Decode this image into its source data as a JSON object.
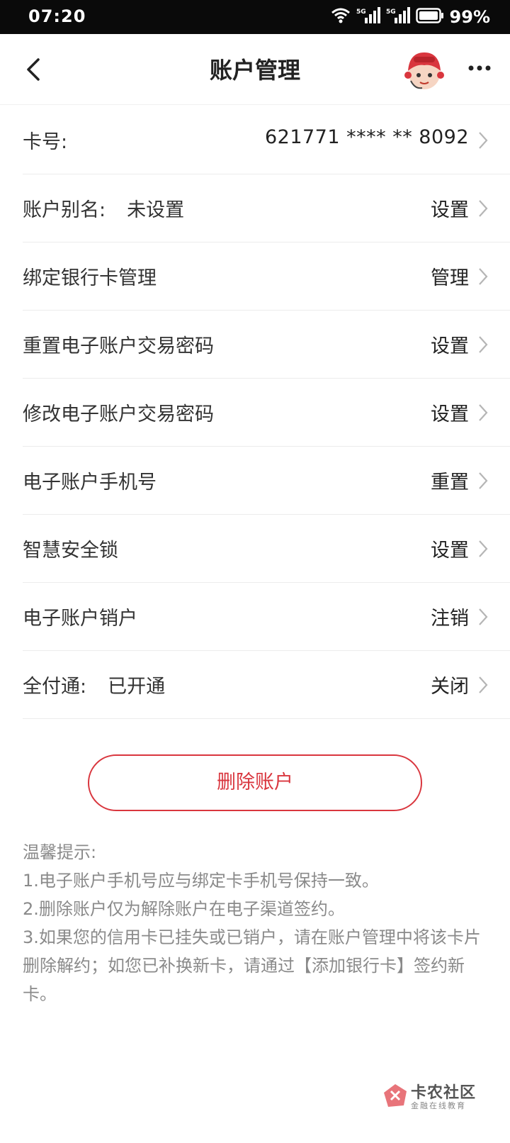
{
  "status_bar": {
    "time": "07:20",
    "battery": "99%",
    "signal_1": "5G",
    "signal_2": "5G",
    "icons": [
      "wifi-icon",
      "signal-5g-icon",
      "signal-5g-icon",
      "battery-icon"
    ]
  },
  "nav": {
    "title": "账户管理",
    "back_icon": "chevron-left-icon",
    "avatar_icon": "mascot-avatar-icon",
    "more_icon": "more-dots-icon"
  },
  "rows": [
    {
      "label": "卡号:",
      "value": "",
      "action": "621771 **** ** 8092"
    },
    {
      "label": "账户别名:",
      "value": "未设置",
      "action": "设置"
    },
    {
      "label": "绑定银行卡管理",
      "value": "",
      "action": "管理"
    },
    {
      "label": "重置电子账户交易密码",
      "value": "",
      "action": "设置"
    },
    {
      "label": "修改电子账户交易密码",
      "value": "",
      "action": "设置"
    },
    {
      "label": "电子账户手机号",
      "value": "",
      "action": "重置"
    },
    {
      "label": "智慧安全锁",
      "value": "",
      "action": "设置"
    },
    {
      "label": "电子账户销户",
      "value": "",
      "action": "注销"
    },
    {
      "label": "全付通:",
      "value": "已开通",
      "action": "关闭"
    }
  ],
  "delete_button": "删除账户",
  "tips": {
    "title": "温馨提示:",
    "items": [
      "1.电子账户手机号应与绑定卡手机号保持一致。",
      "2.删除账户仅为解除账户在电子渠道签约。",
      "3.如果您的信用卡已挂失或已销户，请在账户管理中将该卡片删除解约；如您已补换新卡，请通过【添加银行卡】签约新卡。"
    ]
  },
  "watermark": {
    "name": "卡农社区",
    "sub": "金融在线教育"
  },
  "colors": {
    "accent_red": "#d9363e",
    "tip_gray": "#8a8a8a",
    "status_bar_bg": "#0a0a0a"
  }
}
